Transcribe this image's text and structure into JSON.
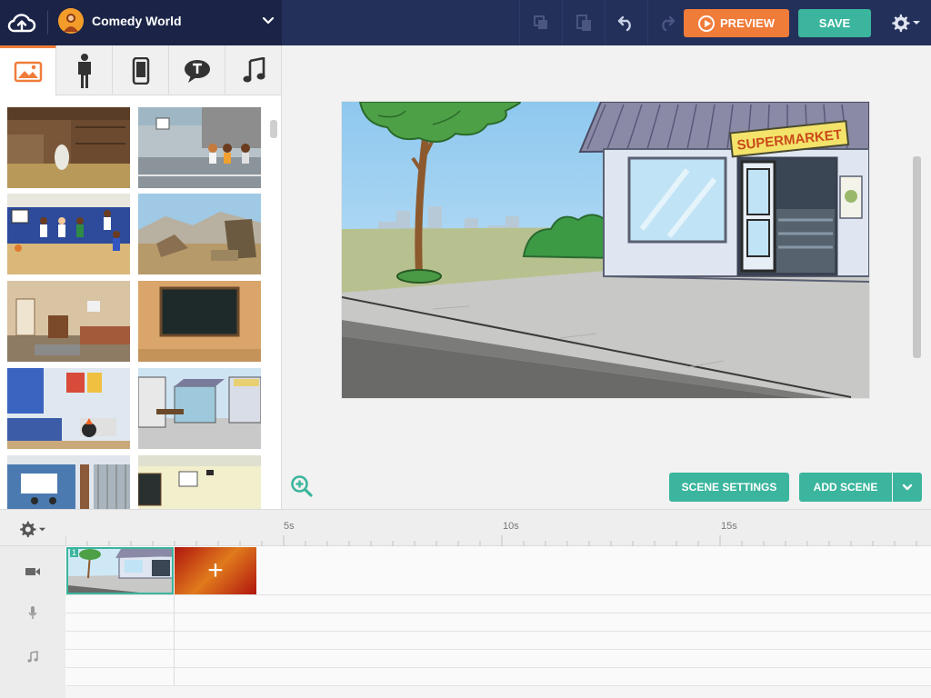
{
  "app": {
    "project_title": "Comedy World"
  },
  "toolbar": {
    "preview_label": "PREVIEW",
    "save_label": "SAVE",
    "icons": [
      "cloud-upload-icon",
      "copy-icon",
      "paste-icon",
      "undo-icon",
      "redo-icon",
      "gear-icon"
    ]
  },
  "categories": [
    {
      "name": "backgrounds",
      "icon": "image-icon",
      "active": true
    },
    {
      "name": "characters",
      "icon": "person-icon",
      "active": false
    },
    {
      "name": "props",
      "icon": "phone-icon",
      "active": false
    },
    {
      "name": "text",
      "icon": "speech-bubble-icon",
      "active": false
    },
    {
      "name": "music",
      "icon": "music-note-icon",
      "active": false
    }
  ],
  "backgrounds": [
    {
      "id": "barn"
    },
    {
      "id": "basketball-court-outdoor"
    },
    {
      "id": "gym"
    },
    {
      "id": "desert-ruins"
    },
    {
      "id": "bedroom"
    },
    {
      "id": "classroom-blackboard"
    },
    {
      "id": "teen-bedroom"
    },
    {
      "id": "bus-stop"
    },
    {
      "id": "school-hallway"
    },
    {
      "id": "classroom"
    }
  ],
  "stage": {
    "scene_settings_label": "SCENE SETTINGS",
    "add_scene_label": "ADD SCENE",
    "canvas_sign": "SUPERMARKET"
  },
  "timeline": {
    "ruler_labels": [
      "5s",
      "10s",
      "15s"
    ],
    "scene_number": "1",
    "add_symbol": "+"
  },
  "colors": {
    "topbar": "#23305a",
    "accent_orange": "#f07c3a",
    "accent_teal": "#3bb59d"
  }
}
